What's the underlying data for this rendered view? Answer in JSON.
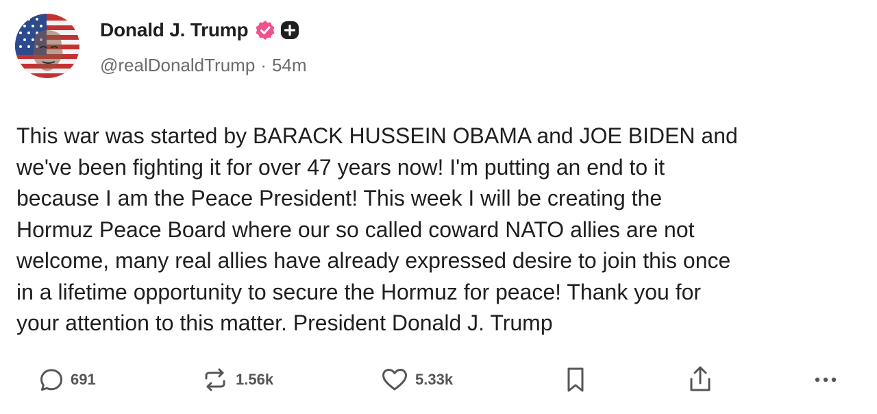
{
  "author": {
    "display_name": "Donald J. Trump",
    "handle": "@realDonaldTrump",
    "separator": "·",
    "time_ago": "54m",
    "avatar": "flag-face-avatar",
    "verified_icon": "verified-badge-icon",
    "plus_icon": "plus-badge-icon"
  },
  "post": {
    "text": "This war was started by BARACK HUSSEIN OBAMA and JOE BIDEN and\nwe've been fighting it for over 47 years now! I'm putting an end to it\nbecause I am the Peace President! This week I will be creating the\nHormuz Peace Board where our so called coward NATO allies are not\nwelcome, many real allies have already expressed desire to join this once\nin a lifetime opportunity to secure the Hormuz for peace! Thank you for\nyour attention to this matter. President Donald J. Trump"
  },
  "actions": {
    "replies": "691",
    "reposts": "1.56k",
    "likes": "5.33k",
    "icons": [
      "reply-icon",
      "repost-icon",
      "like-icon",
      "bookmark-icon",
      "share-icon",
      "more-icon"
    ]
  },
  "colors": {
    "verified": "#f0528e",
    "text": "#1f1f1f",
    "muted": "#6b6b6b",
    "icon": "#555555"
  }
}
